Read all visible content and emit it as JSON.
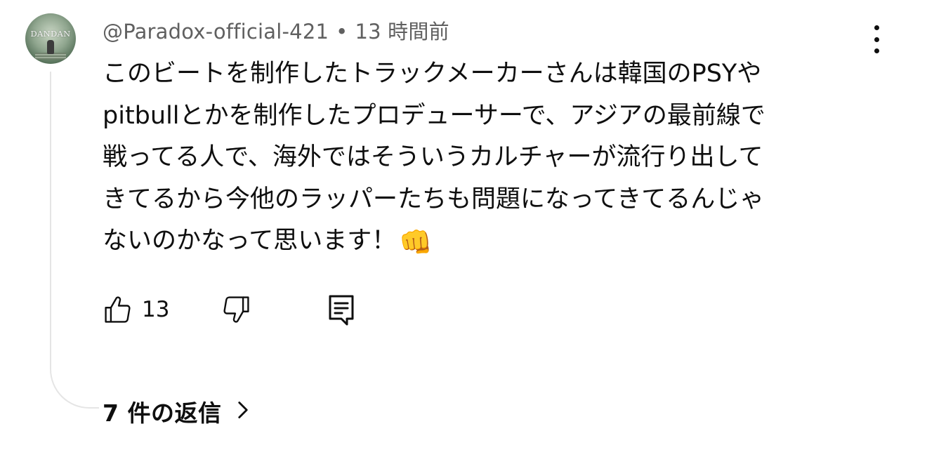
{
  "comment": {
    "author": "@Paradox-official-421",
    "separator": "•",
    "timestamp": "13 時間前",
    "avatar_text": "DANDAN",
    "text_lines": [
      "このビートを制作したトラックメーカーさんは韓国のPSYや",
      "pitbullとかを制作したプロデューサーで、アジアの最前線で",
      "戦ってる人で、海外ではそういうカルチャーが流行り出して",
      "きてるから今他のラッパーたちも問題になってきてるんじゃ",
      "ないのかなって思います！"
    ],
    "emoji": "👊"
  },
  "actions": {
    "like_count": "13",
    "like_icon": "thumb-up-icon",
    "dislike_icon": "thumb-down-icon",
    "reply_icon": "comment-reply-icon"
  },
  "replies": {
    "label": "7 件の返信",
    "chevron_icon": "chevron-right-icon"
  },
  "more_icon": "more-vertical-icon",
  "colors": {
    "text": "#0f0f0f",
    "secondary": "#606060",
    "thread_line": "#e5e5e5"
  }
}
